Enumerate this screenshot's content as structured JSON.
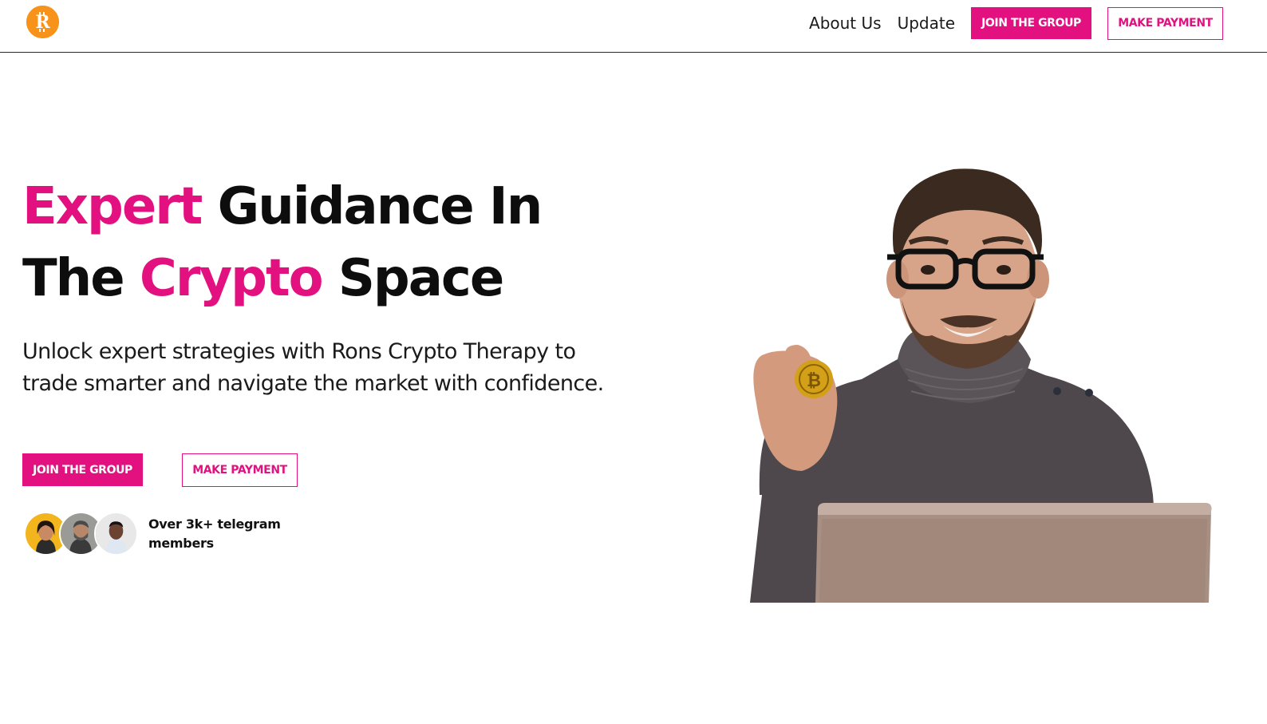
{
  "header": {
    "logo_alt": "R",
    "nav": {
      "about_label": "About Us",
      "update_label": "Update",
      "join_label": "JOIN THE GROUP",
      "payment_label": "MAKE PAYMENT"
    }
  },
  "hero": {
    "title": {
      "word1": "Expert",
      "word2": " Guidance In",
      "word3": "The ",
      "word4": "Crypto",
      "word5": " Space"
    },
    "subtitle": "Unlock expert strategies with Rons Crypto Therapy to trade smarter and navigate the market with confidence.",
    "join_label": "JOIN THE GROUP",
    "payment_label": "MAKE PAYMENT",
    "members_text": "Over 3k+ telegram members"
  },
  "colors": {
    "accent": "#e2117f",
    "logo": "#f7931a",
    "text": "#0d0d0d"
  },
  "icons": {
    "logo": "bitcoin-r-logo-icon",
    "coin": "bitcoin-coin-icon"
  }
}
